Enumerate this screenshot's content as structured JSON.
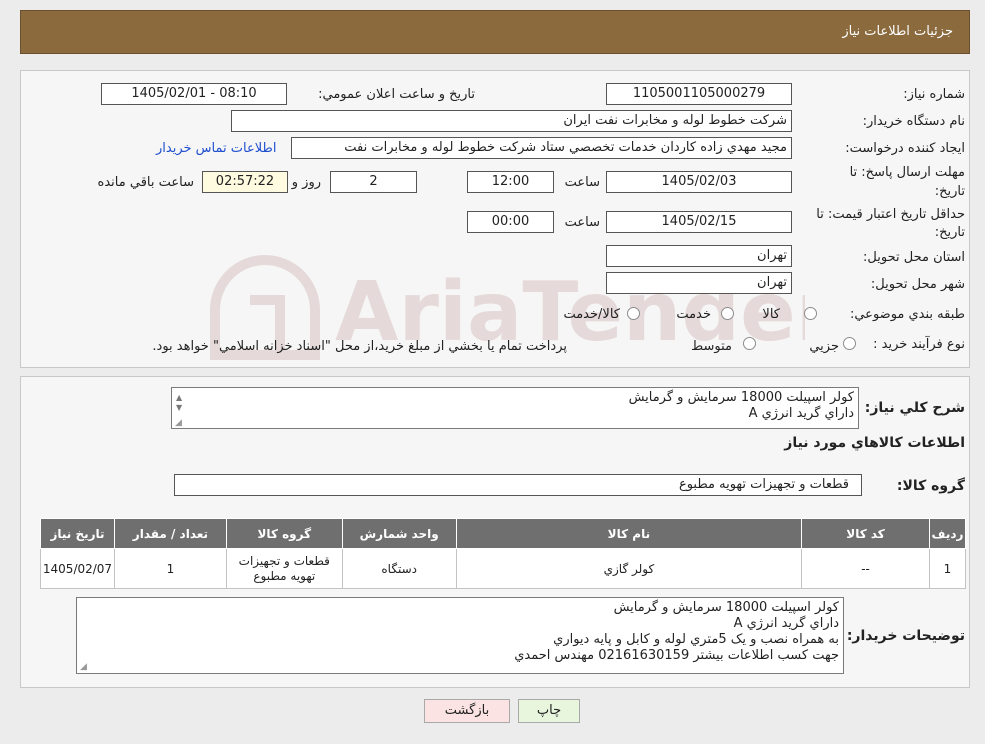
{
  "header": {
    "title": "جزئيات اطلاعات نياز"
  },
  "form": {
    "need_number_label": "شماره نياز:",
    "need_number": "1105001105000279",
    "announce_label": "تاريخ و ساعت اعلان عمومي:",
    "announce_value": "1405/02/01 - 08:10",
    "buyer_org_label": "نام دستگاه خريدار:",
    "buyer_org": "شركت خطوط لوله و مخابرات نفت ايران",
    "creator_label": "ايجاد كننده درخواست:",
    "creator": "مجيد مهدي زاده كاردان خدمات تخصصي ستاد شركت خطوط لوله و مخابرات نفت",
    "contact_link": "اطلاعات تماس خريدار",
    "deadline_label_1": "مهلت ارسال پاسخ: تا",
    "deadline_label_2": "تاريخ:",
    "deadline_date": "1405/02/03",
    "time_label": "ساعت",
    "deadline_time": "12:00",
    "days_value": "2",
    "days_label": "روز و",
    "remaining_time": "02:57:22",
    "remaining_label": "ساعت باقي مانده",
    "validity_label_1": "حداقل تاريخ اعتبار قيمت: تا",
    "validity_label_2": "تاريخ:",
    "validity_date": "1405/02/15",
    "validity_time": "00:00",
    "province_label": "استان محل تحويل:",
    "province": "تهران",
    "city_label": "شهر محل تحويل:",
    "city": "تهران",
    "category_label": "طبقه بندي موضوعي:",
    "category_options": [
      "كالا",
      "خدمت",
      "كالا/خدمت"
    ],
    "process_label": "نوع فرآيند خريد :",
    "process_options": [
      "جزيي",
      "متوسط"
    ],
    "process_note": "پرداخت تمام يا بخشي از مبلغ خريد،از محل \"اسناد خزانه اسلامي\" خواهد بود."
  },
  "summary": {
    "title_label": "شرح كلي نياز:",
    "lines": [
      "كولر اسپيلت 18000 سرمايش و گرمايش",
      "داراي گريد انرژي A"
    ],
    "goods_info_title": "اطلاعات كالاهاي مورد نياز",
    "group_label": "گروه كالا:",
    "group_value": "قطعات و تجهيزات تهويه مطبوع"
  },
  "table": {
    "headers": [
      "رديف",
      "كد كالا",
      "نام كالا",
      "واحد شمارش",
      "گروه كالا",
      "تعداد / مقدار",
      "تاريخ نياز"
    ],
    "row": [
      "1",
      "--",
      "كولر گازي",
      "دستگاه",
      "قطعات و تجهيزات تهويه مطبوع",
      "1",
      "1405/02/07"
    ]
  },
  "buyer_notes": {
    "label": "توضيحات خريدار:",
    "lines": [
      "كولر اسپيلت 18000 سرمايش و گرمايش",
      "داراي گريد انرژي A",
      "به همراه نصب و يک 5متري لوله و كابل و پايه ديواري",
      "جهت كسب اطلاعات بيشتر 02161630159 مهندس احمدي"
    ]
  },
  "buttons": {
    "print": "چاپ",
    "back": "بازگشت"
  },
  "watermark": {
    "text": "AriaTender.neT"
  },
  "colors": {
    "header_bg": "#8b6a3e",
    "table_header_bg": "#6f6f6f",
    "link": "#1e4fcf",
    "back_btn": "#fbe3e3",
    "print_btn": "#e8f6dd"
  }
}
